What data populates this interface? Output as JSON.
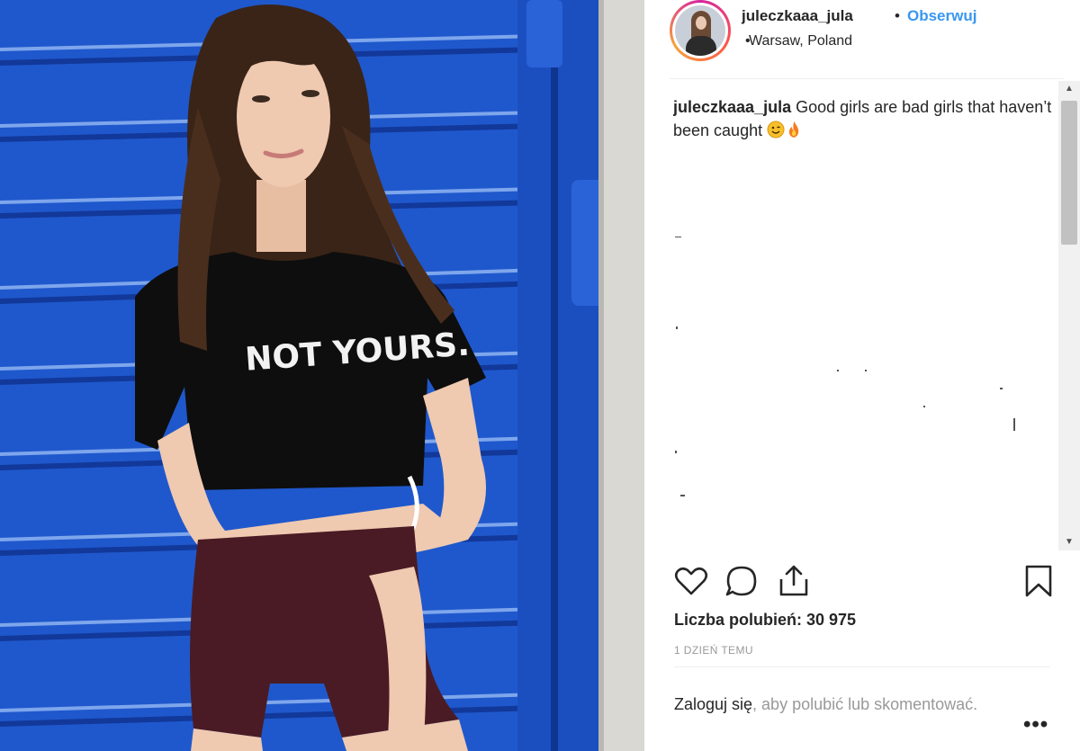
{
  "photo": {
    "shirt_text": "NOT YOURS."
  },
  "post_header": {
    "username": "juleczkaaa_jula",
    "separator": "•",
    "follow_label": "Obserwuj",
    "location_bullet": "•",
    "location": "Warsaw, Poland"
  },
  "caption": {
    "username": "juleczkaaa_jula",
    "text": "Good girls are bad girls that haven’t been caught",
    "emojis": [
      "wink-face-icon",
      "fire-icon"
    ]
  },
  "actions": {
    "icons": [
      "heart-icon",
      "comment-icon",
      "share-icon",
      "bookmark-icon"
    ]
  },
  "likes": "Liczba polubień: 30 975",
  "timestamp": "1 DZIEŃ TEMU",
  "login": {
    "link": "Zaloguj się",
    "rest": ", aby polubić lub skomentować."
  },
  "more_label": "•••",
  "colors": {
    "accent": "#3897f0",
    "text": "#262626",
    "muted": "#999999",
    "door_blue": "#1e55c8"
  }
}
